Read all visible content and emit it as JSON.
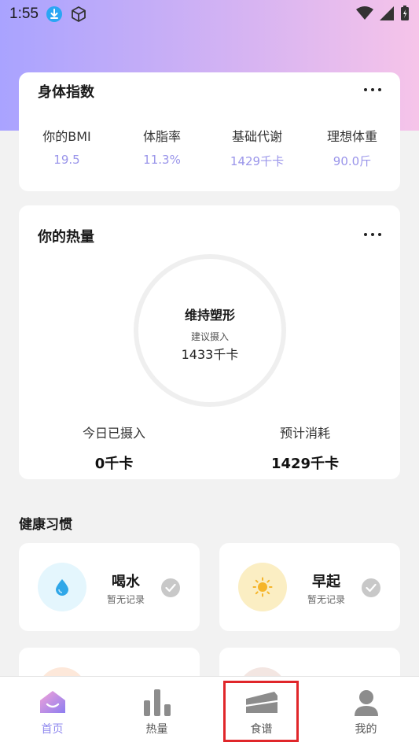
{
  "status_bar": {
    "time": "1:55"
  },
  "body_index": {
    "title": "身体指数",
    "metrics": [
      {
        "label": "你的BMI",
        "value": "19.5"
      },
      {
        "label": "体脂率",
        "value": "11.3%"
      },
      {
        "label": "基础代谢",
        "value": "1429千卡"
      },
      {
        "label": "理想体重",
        "value": "90.0斤"
      }
    ]
  },
  "calories": {
    "title": "你的热量",
    "ring": {
      "title": "维持塑形",
      "subtitle": "建议摄入",
      "value": "1433千卡"
    },
    "intake": {
      "label": "今日已摄入",
      "value": "0千卡"
    },
    "burn": {
      "label": "预计消耗",
      "value": "1429千卡"
    }
  },
  "habits": {
    "title": "健康习惯",
    "items": [
      {
        "name": "喝水",
        "status": "暂无记录",
        "icon": "water-drop-icon",
        "color": "#e4f6fd"
      },
      {
        "name": "早起",
        "status": "暂无记录",
        "icon": "sun-icon",
        "color": "#fbeec3"
      }
    ]
  },
  "bottom_nav": {
    "items": [
      {
        "label": "首页",
        "icon": "home-icon",
        "active": true
      },
      {
        "label": "热量",
        "icon": "bar-chart-icon",
        "active": false
      },
      {
        "label": "食谱",
        "icon": "cake-icon",
        "active": false
      },
      {
        "label": "我的",
        "icon": "person-icon",
        "active": false
      }
    ]
  },
  "colors": {
    "accent": "#8f88ef",
    "highlight": "#e0262a"
  }
}
